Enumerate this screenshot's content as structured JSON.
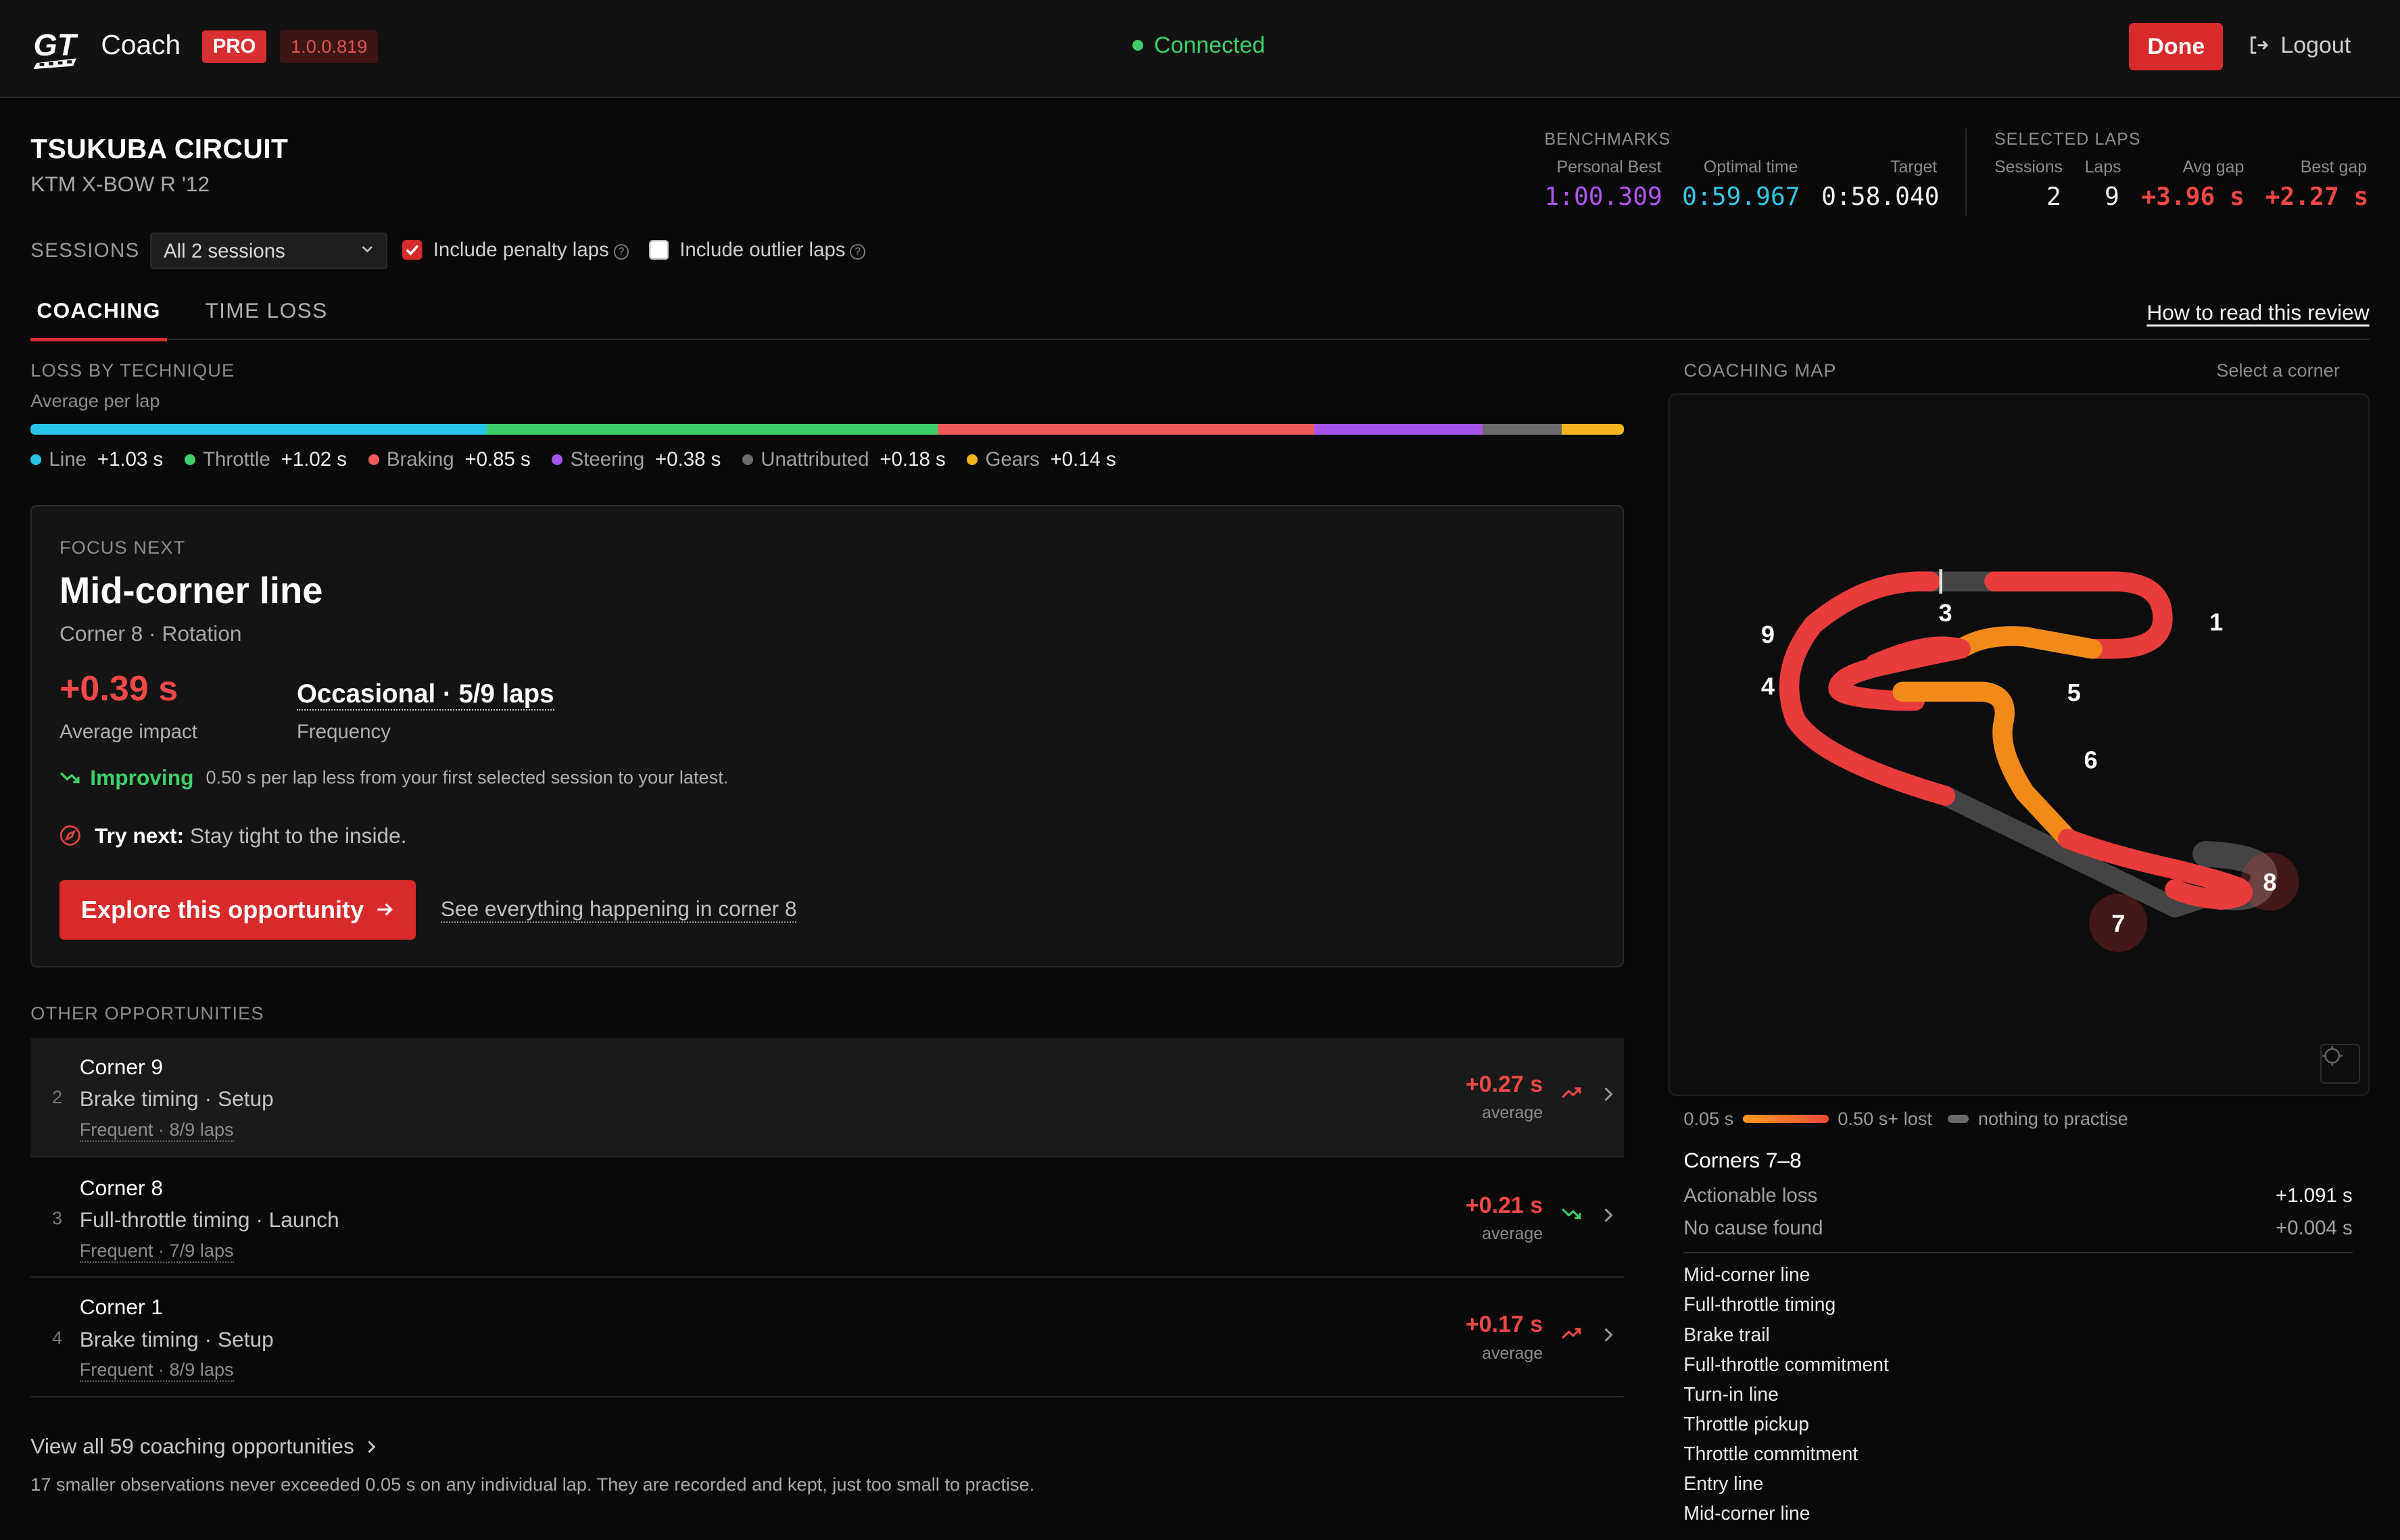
{
  "app": {
    "name": "Coach",
    "badge": "PRO",
    "version": "1.0.0.819",
    "status": "Connected",
    "done": "Done",
    "logout": "Logout"
  },
  "track": {
    "name": "TSUKUBA CIRCUIT",
    "car": "KTM X-BOW R '12"
  },
  "benchmarks": {
    "label": "BENCHMARKS",
    "personal_best_label": "Personal Best",
    "personal_best": "1:00.309",
    "optimal_label": "Optimal time",
    "optimal": "0:59.967",
    "target_label": "Target",
    "target": "0:58.040",
    "colors": {
      "personal_best": "#b057f0",
      "optimal": "#33c8e6",
      "target": "#f2f2f2"
    }
  },
  "selected_laps": {
    "label": "SELECTED LAPS",
    "sessions_label": "Sessions",
    "sessions": "2",
    "laps_label": "Laps",
    "laps": "9",
    "avg_gap_label": "Avg gap",
    "avg_gap": "+3.96 s",
    "best_gap_label": "Best gap",
    "best_gap": "+2.27 s"
  },
  "filters": {
    "sessions_label": "SESSIONS",
    "session_select": "All 2 sessions",
    "penalty_label": "Include penalty laps",
    "penalty_checked": true,
    "outlier_label": "Include outlier laps",
    "outlier_checked": false
  },
  "tabs": {
    "coaching": "COACHING",
    "time_loss": "TIME LOSS",
    "howto": "How to read this review"
  },
  "loss": {
    "title": "LOSS BY TECHNIQUE",
    "subtitle": "Average per lap",
    "items": [
      {
        "name": "Line",
        "value": "+1.03 s",
        "seconds": 1.03,
        "color": "#29c5e6"
      },
      {
        "name": "Throttle",
        "value": "+1.02 s",
        "seconds": 1.02,
        "color": "#3ecf6b"
      },
      {
        "name": "Braking",
        "value": "+0.85 s",
        "seconds": 0.85,
        "color": "#ee5a5a"
      },
      {
        "name": "Steering",
        "value": "+0.38 s",
        "seconds": 0.38,
        "color": "#a455ec"
      },
      {
        "name": "Unattributed",
        "value": "+0.18 s",
        "seconds": 0.18,
        "color": "#6b6b6b"
      },
      {
        "name": "Gears",
        "value": "+0.14 s",
        "seconds": 0.14,
        "color": "#f2b41e"
      }
    ]
  },
  "focus": {
    "label": "FOCUS NEXT",
    "title": "Mid-corner line",
    "subtitle": "Corner 8 · Rotation",
    "impact": "+0.39 s",
    "impact_label": "Average impact",
    "frequency": "Occasional · 5/9 laps",
    "frequency_label": "Frequency",
    "trend_word": "Improving",
    "trend_note": "0.50 s per lap less from your first selected session to your latest.",
    "try_label": "Try next:",
    "try_text": "Stay tight to the inside.",
    "explore": "Explore this opportunity",
    "see_corner": "See everything happening in corner 8"
  },
  "other": {
    "label": "OTHER OPPORTUNITIES",
    "items": [
      {
        "rank": "2",
        "corner": "Corner 9",
        "technique": "Brake timing · Setup",
        "frequency": "Frequent · 8/9 laps",
        "delta": "+0.27 s",
        "avg": "average",
        "trend": "worse"
      },
      {
        "rank": "3",
        "corner": "Corner 8",
        "technique": "Full-throttle timing · Launch",
        "frequency": "Frequent · 7/9 laps",
        "delta": "+0.21 s",
        "avg": "average",
        "trend": "better"
      },
      {
        "rank": "4",
        "corner": "Corner 1",
        "technique": "Brake timing · Setup",
        "frequency": "Frequent · 8/9 laps",
        "delta": "+0.17 s",
        "avg": "average",
        "trend": "worse"
      }
    ],
    "view_all": "View all 59 coaching opportunities",
    "footnote": "17 smaller observations never exceeded 0.05 s on any individual lap. They are recorded and kept, just too small to practise."
  },
  "map": {
    "label": "COACHING MAP",
    "hint": "Select a corner",
    "corner_labels": [
      "1",
      "3",
      "4",
      "5",
      "6",
      "7",
      "8",
      "9"
    ],
    "legend_min": "0.05 s",
    "legend_max": "0.50 s+ lost",
    "legend_none": "nothing to practise"
  },
  "selection": {
    "title": "Corners 7–8",
    "actionable_label": "Actionable loss",
    "actionable": "+1.091 s",
    "nocause_label": "No cause found",
    "nocause": "+0.004 s",
    "techniques": [
      "Mid-corner line",
      "Full-throttle timing",
      "Brake trail",
      "Full-throttle commitment",
      "Turn-in line",
      "Throttle pickup",
      "Throttle commitment",
      "Entry line",
      "Mid-corner line"
    ]
  }
}
